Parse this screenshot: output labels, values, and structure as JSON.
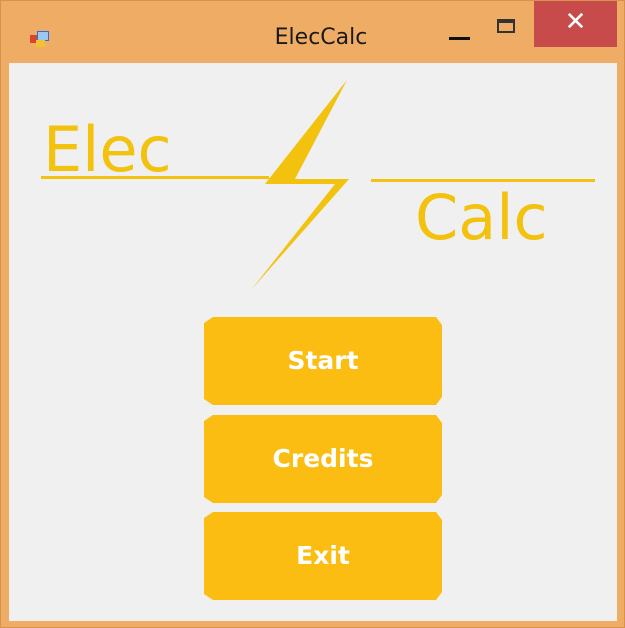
{
  "window": {
    "title": "ElecCalc",
    "close_glyph": "✕",
    "icons": {
      "app": "app-icon",
      "minimize": "minimize-icon",
      "maximize": "maximize-icon",
      "close": "close-icon",
      "logo": "bolt-icon"
    }
  },
  "logo": {
    "word_left": "Elec",
    "word_right": "Calc"
  },
  "buttons": {
    "start": "Start",
    "credits": "Credits",
    "exit": "Exit"
  },
  "colors": {
    "titlebar": "#efac64",
    "close_button": "#c84b4b",
    "accent": "#fbbd12",
    "logo": "#f2c20e",
    "client_background": "#f0f0f0"
  }
}
